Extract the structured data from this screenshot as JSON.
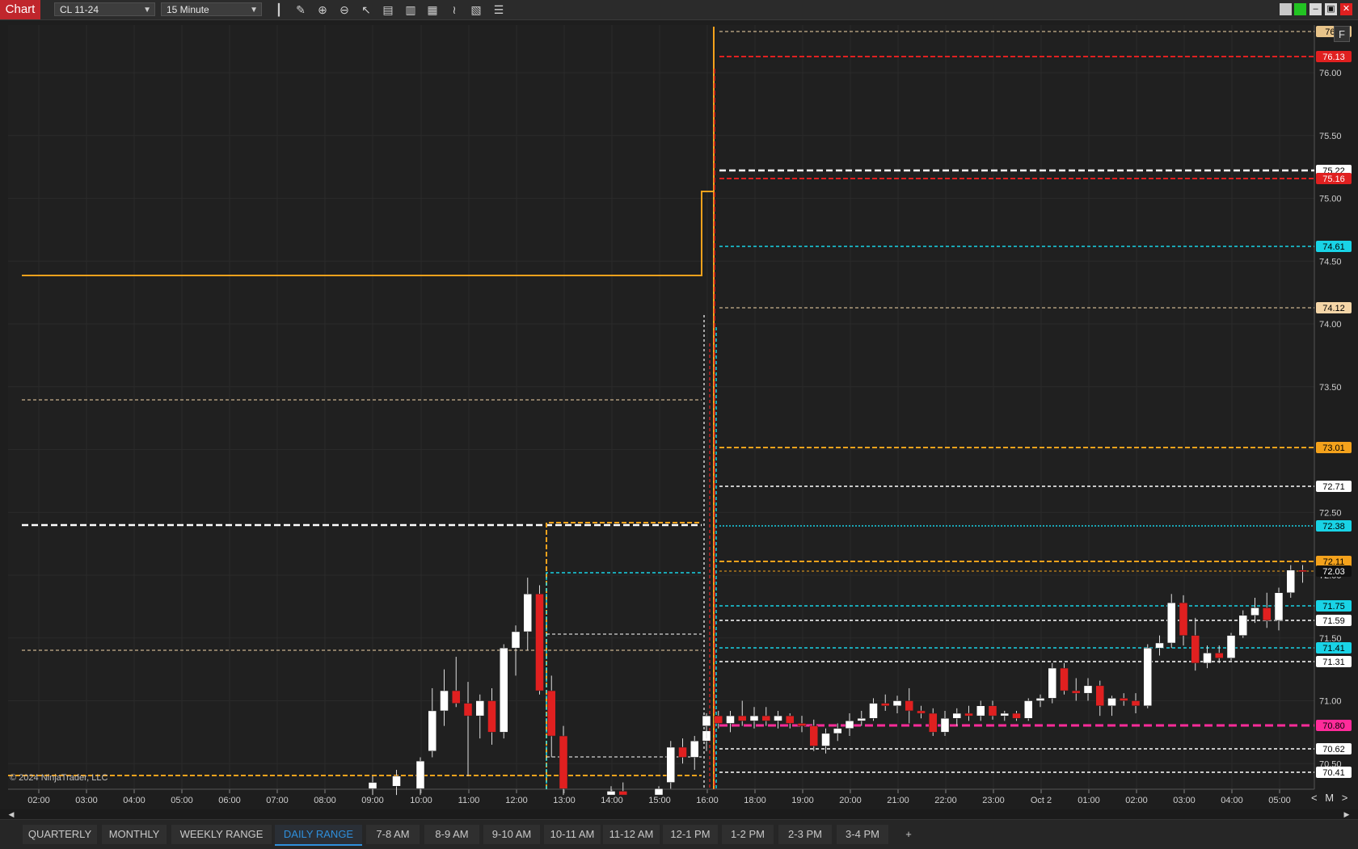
{
  "app": {
    "tag": "Chart",
    "instrument": "CL 11-24",
    "interval": "15 Minute",
    "copyright": "© 2024 NinjaTrader, LLC"
  },
  "toolbar_icons": [
    "bar-type-icon",
    "draw-tools-icon",
    "zoom-in-icon",
    "zoom-out-icon",
    "pointer-icon",
    "data-box-icon",
    "chart-trader-icon",
    "properties-icon",
    "indicators-icon",
    "strategies-icon",
    "object-list-icon"
  ],
  "window_buttons": [
    "pin-icon",
    "link-color-icon",
    "minimize-icon",
    "restore-icon",
    "close-icon"
  ],
  "corner_button": "F",
  "zoom_controls": {
    "left": "<",
    "mode": "M",
    "right": ">"
  },
  "x_axis": {
    "ticks": [
      "02:00",
      "03:00",
      "04:00",
      "05:00",
      "06:00",
      "07:00",
      "08:00",
      "09:00",
      "10:00",
      "11:00",
      "12:00",
      "13:00",
      "14:00",
      "15:00",
      "16:00",
      "18:00",
      "19:00",
      "20:00",
      "21:00",
      "22:00",
      "23:00",
      "Oct 2",
      "01:00",
      "02:00",
      "03:00",
      "04:00",
      "05:00"
    ]
  },
  "chart_data": {
    "type": "candlestick",
    "ylim": [
      70.25,
      76.25
    ],
    "y_ticks": [
      "76.00",
      "75.50",
      "75.00",
      "74.50",
      "74.00",
      "73.50",
      "73.00",
      "72.50",
      "72.00",
      "71.50",
      "71.00",
      "70.50"
    ],
    "candles": [
      {
        "t": "09:00",
        "o": 70.3,
        "h": 70.4,
        "l": 70.25,
        "c": 70.35
      },
      {
        "t": "09:30",
        "o": 70.32,
        "h": 70.45,
        "l": 70.25,
        "c": 70.4
      },
      {
        "t": "10:00",
        "o": 70.3,
        "h": 70.55,
        "l": 70.25,
        "c": 70.52
      },
      {
        "t": "10:15",
        "o": 70.6,
        "h": 71.1,
        "l": 70.55,
        "c": 70.92
      },
      {
        "t": "10:30",
        "o": 70.92,
        "h": 71.25,
        "l": 70.8,
        "c": 71.08
      },
      {
        "t": "10:45",
        "o": 71.08,
        "h": 71.35,
        "l": 70.95,
        "c": 70.98
      },
      {
        "t": "11:00",
        "o": 70.98,
        "h": 71.15,
        "l": 70.4,
        "c": 70.88
      },
      {
        "t": "11:15",
        "o": 70.88,
        "h": 71.05,
        "l": 70.7,
        "c": 71.0
      },
      {
        "t": "11:30",
        "o": 71.0,
        "h": 71.1,
        "l": 70.65,
        "c": 70.75
      },
      {
        "t": "11:45",
        "o": 70.75,
        "h": 71.45,
        "l": 70.7,
        "c": 71.42
      },
      {
        "t": "12:00",
        "o": 71.42,
        "h": 71.6,
        "l": 71.2,
        "c": 71.55
      },
      {
        "t": "12:15",
        "o": 71.55,
        "h": 71.98,
        "l": 71.4,
        "c": 71.85
      },
      {
        "t": "12:30",
        "o": 71.85,
        "h": 71.92,
        "l": 71.05,
        "c": 71.08
      },
      {
        "t": "12:45",
        "o": 71.08,
        "h": 71.2,
        "l": 70.55,
        "c": 70.72
      },
      {
        "t": "13:00",
        "o": 70.72,
        "h": 70.8,
        "l": 70.25,
        "c": 70.3
      },
      {
        "t": "14:00",
        "o": 70.25,
        "h": 70.32,
        "l": 70.25,
        "c": 70.28
      },
      {
        "t": "14:15",
        "o": 70.28,
        "h": 70.35,
        "l": 70.25,
        "c": 70.25
      },
      {
        "t": "15:00",
        "o": 70.25,
        "h": 70.32,
        "l": 70.25,
        "c": 70.3
      },
      {
        "t": "15:15",
        "o": 70.35,
        "h": 70.68,
        "l": 70.3,
        "c": 70.63
      },
      {
        "t": "15:30",
        "o": 70.63,
        "h": 70.7,
        "l": 70.5,
        "c": 70.55
      },
      {
        "t": "15:45",
        "o": 70.55,
        "h": 70.72,
        "l": 70.45,
        "c": 70.68
      },
      {
        "t": "16:00",
        "o": 70.68,
        "h": 70.85,
        "l": 70.6,
        "c": 70.76
      },
      {
        "t": "17:00",
        "o": 70.8,
        "h": 70.9,
        "l": 70.7,
        "c": 70.88
      },
      {
        "t": "17:15",
        "o": 70.88,
        "h": 70.92,
        "l": 70.78,
        "c": 70.82
      },
      {
        "t": "17:30",
        "o": 70.82,
        "h": 70.92,
        "l": 70.75,
        "c": 70.88
      },
      {
        "t": "17:45",
        "o": 70.88,
        "h": 71.0,
        "l": 70.8,
        "c": 70.84
      },
      {
        "t": "18:00",
        "o": 70.84,
        "h": 70.95,
        "l": 70.78,
        "c": 70.88
      },
      {
        "t": "18:15",
        "o": 70.88,
        "h": 70.95,
        "l": 70.8,
        "c": 70.84
      },
      {
        "t": "18:30",
        "o": 70.84,
        "h": 70.92,
        "l": 70.78,
        "c": 70.88
      },
      {
        "t": "18:45",
        "o": 70.88,
        "h": 70.9,
        "l": 70.78,
        "c": 70.82
      },
      {
        "t": "19:00",
        "o": 70.82,
        "h": 70.88,
        "l": 70.75,
        "c": 70.8
      },
      {
        "t": "19:15",
        "o": 70.8,
        "h": 70.85,
        "l": 70.6,
        "c": 70.64
      },
      {
        "t": "19:30",
        "o": 70.64,
        "h": 70.78,
        "l": 70.58,
        "c": 70.74
      },
      {
        "t": "19:45",
        "o": 70.74,
        "h": 70.82,
        "l": 70.68,
        "c": 70.78
      },
      {
        "t": "20:00",
        "o": 70.78,
        "h": 70.9,
        "l": 70.72,
        "c": 70.84
      },
      {
        "t": "20:15",
        "o": 70.84,
        "h": 70.92,
        "l": 70.8,
        "c": 70.86
      },
      {
        "t": "20:30",
        "o": 70.86,
        "h": 71.02,
        "l": 70.84,
        "c": 70.98
      },
      {
        "t": "20:45",
        "o": 70.98,
        "h": 71.05,
        "l": 70.92,
        "c": 70.96
      },
      {
        "t": "21:00",
        "o": 70.96,
        "h": 71.04,
        "l": 70.9,
        "c": 71.0
      },
      {
        "t": "21:15",
        "o": 71.0,
        "h": 71.1,
        "l": 70.82,
        "c": 70.92
      },
      {
        "t": "21:30",
        "o": 70.92,
        "h": 70.96,
        "l": 70.86,
        "c": 70.9
      },
      {
        "t": "21:45",
        "o": 70.9,
        "h": 70.94,
        "l": 70.72,
        "c": 70.75
      },
      {
        "t": "22:00",
        "o": 70.75,
        "h": 70.92,
        "l": 70.72,
        "c": 70.86
      },
      {
        "t": "22:15",
        "o": 70.86,
        "h": 70.94,
        "l": 70.8,
        "c": 70.9
      },
      {
        "t": "22:30",
        "o": 70.9,
        "h": 70.96,
        "l": 70.84,
        "c": 70.88
      },
      {
        "t": "22:45",
        "o": 70.88,
        "h": 71.0,
        "l": 70.84,
        "c": 70.96
      },
      {
        "t": "23:00",
        "o": 70.96,
        "h": 71.0,
        "l": 70.85,
        "c": 70.88
      },
      {
        "t": "23:15",
        "o": 70.88,
        "h": 70.92,
        "l": 70.84,
        "c": 70.9
      },
      {
        "t": "23:30",
        "o": 70.9,
        "h": 70.92,
        "l": 70.84,
        "c": 70.86
      },
      {
        "t": "23:45",
        "o": 70.86,
        "h": 71.02,
        "l": 70.84,
        "c": 71.0
      },
      {
        "t": "00:00",
        "o": 71.0,
        "h": 71.05,
        "l": 70.95,
        "c": 71.02
      },
      {
        "t": "00:15",
        "o": 71.02,
        "h": 71.3,
        "l": 70.98,
        "c": 71.26
      },
      {
        "t": "00:30",
        "o": 71.26,
        "h": 71.3,
        "l": 71.05,
        "c": 71.08
      },
      {
        "t": "00:45",
        "o": 71.08,
        "h": 71.18,
        "l": 71.0,
        "c": 71.06
      },
      {
        "t": "01:00",
        "o": 71.06,
        "h": 71.18,
        "l": 71.0,
        "c": 71.12
      },
      {
        "t": "01:15",
        "o": 71.12,
        "h": 71.16,
        "l": 70.88,
        "c": 70.96
      },
      {
        "t": "01:30",
        "o": 70.96,
        "h": 71.04,
        "l": 70.88,
        "c": 71.02
      },
      {
        "t": "01:45",
        "o": 71.02,
        "h": 71.06,
        "l": 70.96,
        "c": 71.0
      },
      {
        "t": "02:00",
        "o": 71.0,
        "h": 71.06,
        "l": 70.9,
        "c": 70.96
      },
      {
        "t": "02:15",
        "o": 70.96,
        "h": 71.45,
        "l": 70.94,
        "c": 71.42
      },
      {
        "t": "02:30",
        "o": 71.42,
        "h": 71.52,
        "l": 71.36,
        "c": 71.46
      },
      {
        "t": "02:45",
        "o": 71.46,
        "h": 71.85,
        "l": 71.42,
        "c": 71.78
      },
      {
        "t": "03:00",
        "o": 71.78,
        "h": 71.84,
        "l": 71.44,
        "c": 71.52
      },
      {
        "t": "03:15",
        "o": 71.52,
        "h": 71.66,
        "l": 71.24,
        "c": 71.3
      },
      {
        "t": "03:30",
        "o": 71.3,
        "h": 71.44,
        "l": 71.26,
        "c": 71.38
      },
      {
        "t": "03:45",
        "o": 71.38,
        "h": 71.44,
        "l": 71.3,
        "c": 71.34
      },
      {
        "t": "04:00",
        "o": 71.34,
        "h": 71.54,
        "l": 71.32,
        "c": 71.52
      },
      {
        "t": "04:15",
        "o": 71.52,
        "h": 71.72,
        "l": 71.5,
        "c": 71.68
      },
      {
        "t": "04:30",
        "o": 71.68,
        "h": 71.82,
        "l": 71.62,
        "c": 71.74
      },
      {
        "t": "04:45",
        "o": 71.74,
        "h": 71.86,
        "l": 71.58,
        "c": 71.64
      },
      {
        "t": "05:00",
        "o": 71.64,
        "h": 71.9,
        "l": 71.56,
        "c": 71.86
      },
      {
        "t": "05:15",
        "o": 71.86,
        "h": 72.08,
        "l": 71.82,
        "c": 72.04
      },
      {
        "t": "05:30",
        "o": 72.04,
        "h": 72.08,
        "l": 71.94,
        "c": 72.03
      }
    ],
    "price_levels": [
      {
        "label": "76.3",
        "color": "#e8c48a",
        "text": "#000"
      },
      {
        "label": "76.13",
        "color": "#e02020",
        "text": "#fff"
      },
      {
        "label": "75.22",
        "color": "#ffffff",
        "text": "#000"
      },
      {
        "label": "75.16",
        "color": "#e02020",
        "text": "#fff"
      },
      {
        "label": "74.61",
        "color": "#19d3e6",
        "text": "#000"
      },
      {
        "label": "74.12",
        "color": "#f5d6a8",
        "text": "#000"
      },
      {
        "label": "73.01",
        "color": "#f4a21c",
        "text": "#000"
      },
      {
        "label": "72.71",
        "color": "#ffffff",
        "text": "#000"
      },
      {
        "label": "72.38",
        "color": "#19d3e6",
        "text": "#000"
      },
      {
        "label": "72.11",
        "color": "#f4a21c",
        "text": "#000"
      },
      {
        "label": "72.03",
        "color": "#111111",
        "text": "#fff"
      },
      {
        "label": "71.75",
        "color": "#19d3e6",
        "text": "#000"
      },
      {
        "label": "71.59",
        "color": "#ffffff",
        "text": "#000"
      },
      {
        "label": "71.41",
        "color": "#19d3e6",
        "text": "#000"
      },
      {
        "label": "71.31",
        "color": "#ffffff",
        "text": "#000"
      },
      {
        "label": "70.80",
        "color": "#ff2b9a",
        "text": "#000"
      },
      {
        "label": "70.62",
        "color": "#ffffff",
        "text": "#000"
      },
      {
        "label": "70.41",
        "color": "#ffffff",
        "text": "#000"
      }
    ]
  },
  "tabs": [
    {
      "label": "QUARTERLY",
      "active": false
    },
    {
      "label": "MONTHLY",
      "active": false
    },
    {
      "label": "WEEKLY RANGE",
      "active": false
    },
    {
      "label": "DAILY RANGE",
      "active": true
    },
    {
      "label": "7-8  AM",
      "active": false
    },
    {
      "label": "8-9 AM",
      "active": false
    },
    {
      "label": "9-10 AM",
      "active": false
    },
    {
      "label": "10-11 AM",
      "active": false
    },
    {
      "label": "11-12 AM",
      "active": false
    },
    {
      "label": "12-1 PM",
      "active": false
    },
    {
      "label": "1-2 PM",
      "active": false
    },
    {
      "label": "2-3 PM",
      "active": false
    },
    {
      "label": "3-4 PM",
      "active": false
    }
  ],
  "add_tab": "+"
}
